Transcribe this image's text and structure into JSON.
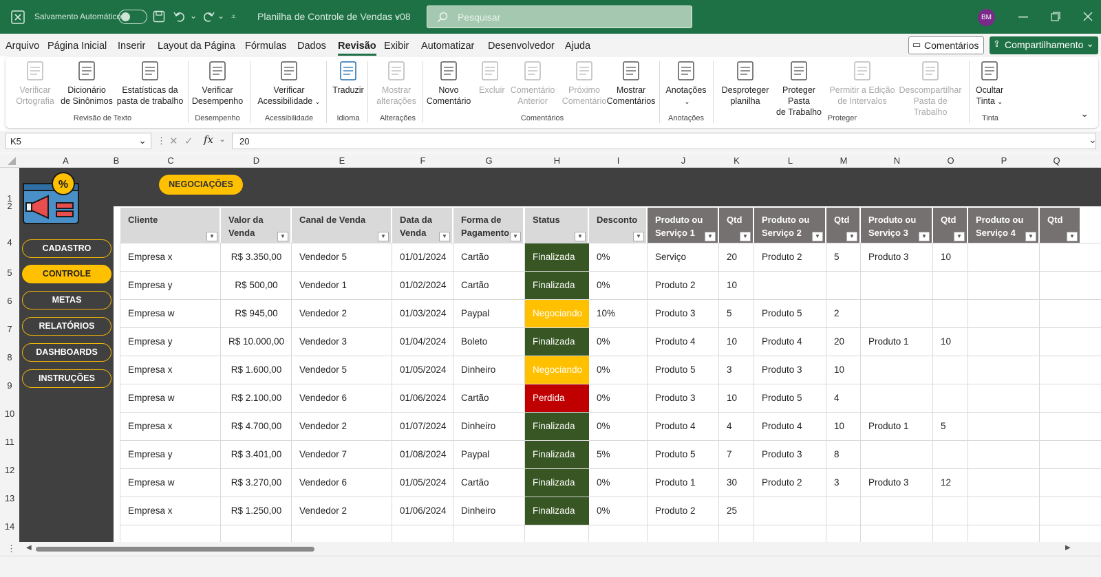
{
  "title_bar": {
    "autosave_label": "Salvamento Automático",
    "file_name": "Planilha de Controle de Vendas v08",
    "search_placeholder": "Pesquisar",
    "avatar_initials": "BM"
  },
  "menu": {
    "items": [
      "Arquivo",
      "Página Inicial",
      "Inserir",
      "Layout da Página",
      "Fórmulas",
      "Dados",
      "Revisão",
      "Exibir",
      "Automatizar",
      "Desenvolvedor",
      "Ajuda"
    ],
    "active": "Revisão",
    "comments_button": "Comentários",
    "share_button": "Compartilhamento"
  },
  "ribbon": {
    "buttons": [
      {
        "l1": "Verificar",
        "l2": "Ortografia",
        "disabled": true,
        "icon": "spelling-icon"
      },
      {
        "l1": "Dicionário",
        "l2": "de Sinônimos",
        "disabled": false,
        "icon": "thesaurus-icon"
      },
      {
        "l1": "Estatísticas da",
        "l2": "pasta de trabalho",
        "disabled": false,
        "icon": "workbook-stats-icon"
      },
      {
        "l1": "Verificar",
        "l2": "Desempenho",
        "disabled": false,
        "icon": "performance-icon"
      },
      {
        "l1": "Verificar",
        "l2": "Acessibilidade",
        "disabled": false,
        "icon": "accessibility-icon"
      },
      {
        "l1": "Traduzir",
        "l2": "",
        "disabled": false,
        "icon": "translate-icon"
      },
      {
        "l1": "Mostrar",
        "l2": "alterações",
        "disabled": true,
        "icon": "show-changes-icon"
      },
      {
        "l1": "Novo",
        "l2": "Comentário",
        "disabled": false,
        "icon": "new-comment-icon"
      },
      {
        "l1": "Excluir",
        "l2": "",
        "disabled": true,
        "icon": "delete-comment-icon"
      },
      {
        "l1": "Comentário",
        "l2": "Anterior",
        "disabled": true,
        "icon": "previous-comment-icon"
      },
      {
        "l1": "Próximo",
        "l2": "Comentário",
        "disabled": true,
        "icon": "next-comment-icon"
      },
      {
        "l1": "Mostrar",
        "l2": "Comentários",
        "disabled": false,
        "icon": "show-comments-icon"
      },
      {
        "l1": "Anotações",
        "l2": "",
        "disabled": false,
        "icon": "notes-icon"
      },
      {
        "l1": "Desproteger",
        "l2": "planilha",
        "disabled": false,
        "icon": "unprotect-sheet-icon"
      },
      {
        "l1": "Proteger Pasta",
        "l2": "de Trabalho",
        "disabled": false,
        "icon": "protect-workbook-icon"
      },
      {
        "l1": "Permitir a Edição",
        "l2": "de Intervalos",
        "disabled": true,
        "icon": "allow-edit-ranges-icon"
      },
      {
        "l1": "Descompartilhar",
        "l2": "Pasta de Trabalho",
        "disabled": true,
        "icon": "unshare-workbook-icon"
      },
      {
        "l1": "Ocultar",
        "l2": "Tinta",
        "disabled": false,
        "icon": "hide-ink-icon"
      }
    ],
    "groups": [
      "Revisão de Texto",
      "Desempenho",
      "Acessibilidade",
      "Idioma",
      "Alterações",
      "Comentários",
      "Anotações",
      "Proteger",
      "Tinta"
    ]
  },
  "formula_bar": {
    "name_box": "K5",
    "fx": "fx",
    "value": "20"
  },
  "columns": [
    "A",
    "B",
    "C",
    "D",
    "E",
    "F",
    "G",
    "H",
    "I",
    "J",
    "K",
    "L",
    "M",
    "N",
    "O",
    "P",
    "Q"
  ],
  "rows": [
    "1",
    "2",
    "4",
    "5",
    "6",
    "7",
    "8",
    "9",
    "10",
    "11",
    "12",
    "13",
    "14"
  ],
  "sheet": {
    "top_button": "NEGOCIAÇÕES",
    "nav": [
      "CADASTRO",
      "CONTROLE",
      "METAS",
      "RELATÓRIOS",
      "DASHBOARDS",
      "INSTRUÇÕES"
    ],
    "nav_active": "CONTROLE",
    "headers": [
      {
        "l1": "Cliente",
        "l2": ""
      },
      {
        "l1": "Valor da Venda",
        "l2": ""
      },
      {
        "l1": "Canal de Venda",
        "l2": ""
      },
      {
        "l1": "Data da",
        "l2": "Venda"
      },
      {
        "l1": "Forma de",
        "l2": "Pagamento"
      },
      {
        "l1": "Status",
        "l2": ""
      },
      {
        "l1": "Desconto",
        "l2": ""
      },
      {
        "l1": "Produto ou",
        "l2": "Serviço 1"
      },
      {
        "l1": "Qtd",
        "l2": ""
      },
      {
        "l1": "Produto ou",
        "l2": "Serviço 2"
      },
      {
        "l1": "Qtd",
        "l2": ""
      },
      {
        "l1": "Produto ou",
        "l2": "Serviço 3"
      },
      {
        "l1": "Qtd",
        "l2": ""
      },
      {
        "l1": "Produto ou",
        "l2": "Serviço 4"
      },
      {
        "l1": "Qtd",
        "l2": ""
      }
    ],
    "rows": [
      [
        "Empresa x",
        "R$ 3.350,00",
        "Vendedor 5",
        "01/01/2024",
        "Cartão",
        "Finalizada",
        "0%",
        "Serviço",
        "20",
        "Produto 2",
        "5",
        "Produto 3",
        "10",
        "",
        ""
      ],
      [
        "Empresa y",
        "R$ 500,00",
        "Vendedor 1",
        "01/02/2024",
        "Cartão",
        "Finalizada",
        "0%",
        "Produto 2",
        "10",
        "",
        "",
        "",
        "",
        "",
        ""
      ],
      [
        "Empresa w",
        "R$ 945,00",
        "Vendedor 2",
        "01/03/2024",
        "Paypal",
        "Negociando",
        "10%",
        "Produto 3",
        "5",
        "Produto 5",
        "2",
        "",
        "",
        "",
        ""
      ],
      [
        "Empresa y",
        "R$ 10.000,00",
        "Vendedor 3",
        "01/04/2024",
        "Boleto",
        "Finalizada",
        "0%",
        "Produto 4",
        "10",
        "Produto 4",
        "20",
        "Produto 1",
        "10",
        "",
        ""
      ],
      [
        "Empresa x",
        "R$ 1.600,00",
        "Vendedor 5",
        "01/05/2024",
        "Dinheiro",
        "Negociando",
        "0%",
        "Produto 5",
        "3",
        "Produto 3",
        "10",
        "",
        "",
        "",
        ""
      ],
      [
        "Empresa w",
        "R$ 2.100,00",
        "Vendedor 6",
        "01/06/2024",
        "Cartão",
        "Perdida",
        "0%",
        "Produto 3",
        "10",
        "Produto 5",
        "4",
        "",
        "",
        "",
        ""
      ],
      [
        "Empresa x",
        "R$ 4.700,00",
        "Vendedor 2",
        "01/07/2024",
        "Dinheiro",
        "Finalizada",
        "0%",
        "Produto 4",
        "4",
        "Produto 4",
        "10",
        "Produto 1",
        "5",
        "",
        ""
      ],
      [
        "Empresa y",
        "R$ 3.401,00",
        "Vendedor 7",
        "01/08/2024",
        "Paypal",
        "Finalizada",
        "5%",
        "Produto 5",
        "7",
        "Produto 3",
        "8",
        "",
        "",
        "",
        ""
      ],
      [
        "Empresa w",
        "R$ 3.270,00",
        "Vendedor 6",
        "01/05/2024",
        "Cartão",
        "Finalizada",
        "0%",
        "Produto 1",
        "30",
        "Produto 2",
        "3",
        "Produto 3",
        "12",
        "",
        ""
      ],
      [
        "Empresa x",
        "R$ 1.250,00",
        "Vendedor 2",
        "01/06/2024",
        "Dinheiro",
        "Finalizada",
        "0%",
        "Produto 2",
        "25",
        "",
        "",
        "",
        "",
        "",
        ""
      ]
    ],
    "status_colors": {
      "Finalizada": "#375623",
      "Negociando": "#ffc000",
      "Perdida": "#c00000"
    }
  }
}
